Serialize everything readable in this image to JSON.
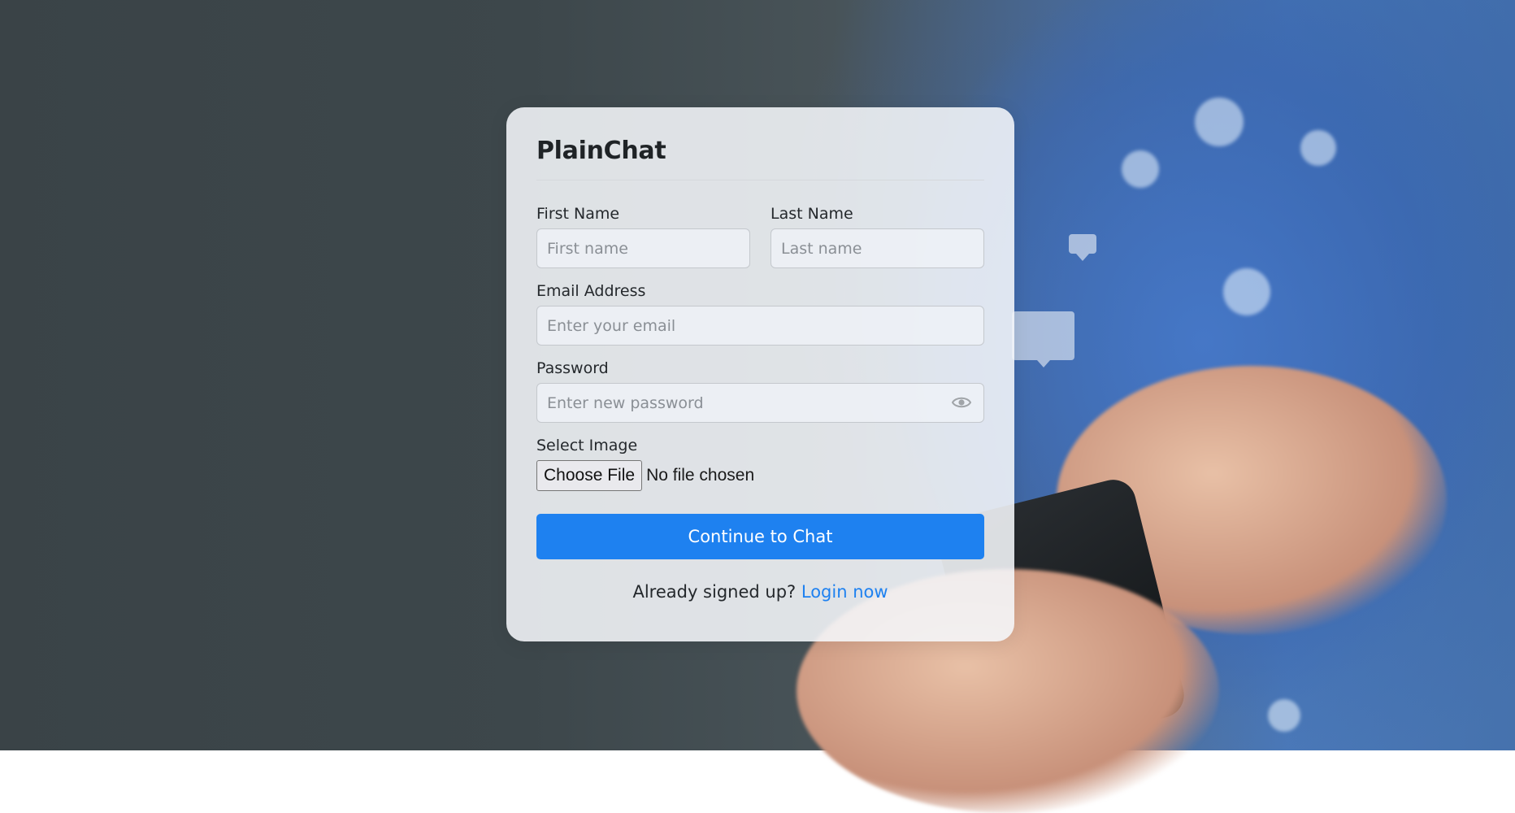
{
  "brand": {
    "name": "PlainChat",
    "accent_color": "#1e81f0"
  },
  "form": {
    "first_name": {
      "label": "First Name",
      "placeholder": "First name",
      "value": ""
    },
    "last_name": {
      "label": "Last Name",
      "placeholder": "Last name",
      "value": ""
    },
    "email": {
      "label": "Email Address",
      "placeholder": "Enter your email",
      "value": ""
    },
    "password": {
      "label": "Password",
      "placeholder": "Enter new password",
      "value": "",
      "toggle_icon": "eye-icon"
    },
    "image": {
      "label": "Select Image",
      "button_label": "Choose File",
      "status": "No file chosen"
    },
    "submit_label": "Continue to Chat"
  },
  "footer": {
    "prompt": "Already signed up?",
    "link_label": "Login now"
  }
}
